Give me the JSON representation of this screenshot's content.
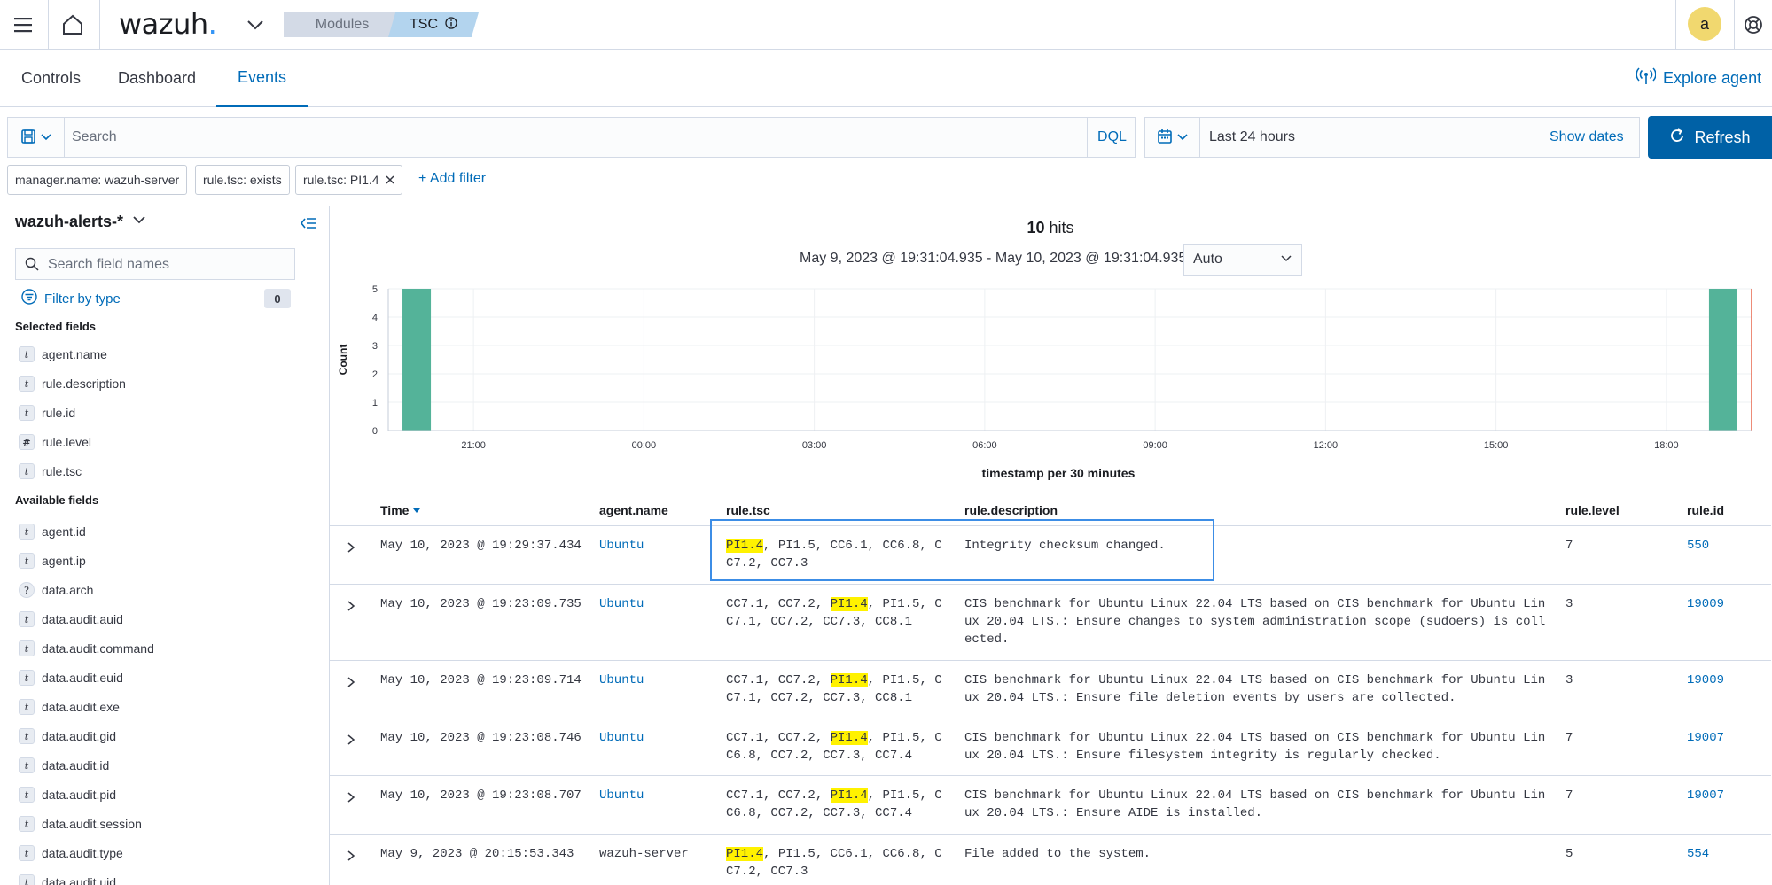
{
  "header": {
    "logo_text": "wazuh",
    "logo_dot": ".",
    "breadcrumbs": [
      "Modules",
      "TSC"
    ],
    "avatar_letter": "a"
  },
  "tabs": [
    "Controls",
    "Dashboard",
    "Events"
  ],
  "active_tab": "Events",
  "explore_agent": "Explore agent",
  "query": {
    "placeholder": "Search",
    "language": "DQL",
    "time_range": "Last 24 hours",
    "show_dates": "Show dates",
    "refresh_label": "Refresh"
  },
  "filters": [
    "manager.name: wazuh-server",
    "rule.tsc: exists",
    "rule.tsc: PI1.4"
  ],
  "add_filter": "+ Add filter",
  "sidebar": {
    "index_pattern": "wazuh-alerts-*",
    "field_search_placeholder": "Search field names",
    "filter_by_type": "Filter by type",
    "filter_count": "0",
    "selected_title": "Selected fields",
    "selected_fields": [
      {
        "type": "t",
        "name": "agent.name"
      },
      {
        "type": "t",
        "name": "rule.description"
      },
      {
        "type": "t",
        "name": "rule.id"
      },
      {
        "type": "#",
        "name": "rule.level"
      },
      {
        "type": "t",
        "name": "rule.tsc"
      }
    ],
    "available_title": "Available fields",
    "available_fields": [
      {
        "type": "t",
        "name": "agent.id"
      },
      {
        "type": "t",
        "name": "agent.ip"
      },
      {
        "type": "?",
        "name": "data.arch"
      },
      {
        "type": "t",
        "name": "data.audit.auid"
      },
      {
        "type": "t",
        "name": "data.audit.command"
      },
      {
        "type": "t",
        "name": "data.audit.euid"
      },
      {
        "type": "t",
        "name": "data.audit.exe"
      },
      {
        "type": "t",
        "name": "data.audit.gid"
      },
      {
        "type": "t",
        "name": "data.audit.id"
      },
      {
        "type": "t",
        "name": "data.audit.pid"
      },
      {
        "type": "t",
        "name": "data.audit.session"
      },
      {
        "type": "t",
        "name": "data.audit.type"
      },
      {
        "type": "t",
        "name": "data.audit.uid"
      }
    ]
  },
  "results": {
    "hits_count": "10",
    "hits_label": "hits",
    "date_range": "May 9, 2023 @ 19:31:04.935 - May 10, 2023 @ 19:31:04.935",
    "interval": "Auto"
  },
  "chart_data": {
    "type": "bar",
    "ylabel": "Count",
    "xlabel": "timestamp per 30 minutes",
    "ylim": [
      0,
      5
    ],
    "y_ticks": [
      0,
      1,
      2,
      3,
      4,
      5
    ],
    "x_ticks": [
      "21:00",
      "00:00",
      "03:00",
      "06:00",
      "09:00",
      "12:00",
      "15:00",
      "18:00"
    ],
    "x_tick_hours": [
      1.5,
      4.5,
      7.5,
      10.5,
      13.5,
      16.5,
      19.5,
      22.5
    ],
    "bars": [
      {
        "hours_from_start": 0.5,
        "value": 5
      },
      {
        "hours_from_start": 23.5,
        "value": 5
      }
    ],
    "bar_color": "#54b399",
    "now_marker_color": "#e7664c"
  },
  "table": {
    "columns": [
      "Time",
      "agent.name",
      "rule.tsc",
      "rule.description",
      "rule.level",
      "rule.id"
    ],
    "rows": [
      {
        "time": "May 10, 2023 @ 19:29:37.434",
        "agent": "Ubuntu",
        "tsc_lines": [
          "PI1.4, PI1.5, CC6.1, CC6.8, C",
          "C7.2, CC7.3"
        ],
        "desc_lines": [
          "Integrity checksum changed."
        ],
        "level": "7",
        "id": "550"
      },
      {
        "time": "May 10, 2023 @ 19:23:09.735",
        "agent": "Ubuntu",
        "tsc_lines": [
          "CC7.1, CC7.2, PI1.4, PI1.5, C",
          "C7.1, CC7.2, CC7.3, CC8.1"
        ],
        "desc_lines": [
          "CIS benchmark for Ubuntu Linux 22.04 LTS based on CIS benchmark for Ubuntu Lin",
          "ux 20.04 LTS.: Ensure changes to system administration scope (sudoers) is coll",
          "ected."
        ],
        "level": "3",
        "id": "19009"
      },
      {
        "time": "May 10, 2023 @ 19:23:09.714",
        "agent": "Ubuntu",
        "tsc_lines": [
          "CC7.1, CC7.2, PI1.4, PI1.5, C",
          "C7.1, CC7.2, CC7.3, CC8.1"
        ],
        "desc_lines": [
          "CIS benchmark for Ubuntu Linux 22.04 LTS based on CIS benchmark for Ubuntu Lin",
          "ux 20.04 LTS.: Ensure file deletion events by users are collected."
        ],
        "level": "3",
        "id": "19009"
      },
      {
        "time": "May 10, 2023 @ 19:23:08.746",
        "agent": "Ubuntu",
        "tsc_lines": [
          "CC7.1, CC7.2, PI1.4, PI1.5, C",
          "C6.8, CC7.2, CC7.3, CC7.4"
        ],
        "desc_lines": [
          "CIS benchmark for Ubuntu Linux 22.04 LTS based on CIS benchmark for Ubuntu Lin",
          "ux 20.04 LTS.: Ensure filesystem integrity is regularly checked."
        ],
        "level": "7",
        "id": "19007"
      },
      {
        "time": "May 10, 2023 @ 19:23:08.707",
        "agent": "Ubuntu",
        "tsc_lines": [
          "CC7.1, CC7.2, PI1.4, PI1.5, C",
          "C6.8, CC7.2, CC7.3, CC7.4"
        ],
        "desc_lines": [
          "CIS benchmark for Ubuntu Linux 22.04 LTS based on CIS benchmark for Ubuntu Lin",
          "ux 20.04 LTS.: Ensure AIDE is installed."
        ],
        "level": "7",
        "id": "19007"
      },
      {
        "time": "May 9, 2023 @ 20:15:53.343",
        "agent": "wazuh-server",
        "tsc_lines": [
          "PI1.4, PI1.5, CC6.1, CC6.8, C",
          "C7.2, CC7.3"
        ],
        "desc_lines": [
          "File added to the system."
        ],
        "level": "5",
        "id": "554"
      }
    ],
    "highlight_term": "PI1.4"
  },
  "colors": {
    "accent": "#006bb8",
    "primary_button": "#0061a6",
    "highlight": "#fff200",
    "avatar": "#f1d86f"
  }
}
